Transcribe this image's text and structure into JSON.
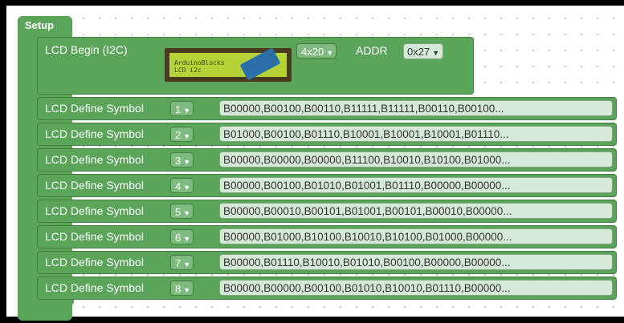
{
  "setup": {
    "label": "Setup"
  },
  "begin": {
    "label": "LCD Begin (I2C)",
    "image_text_line1": "ArduinoBlocks",
    "image_text_line2": "LCD i2c",
    "size_value": "4x20",
    "addr_label": "ADDR",
    "addr_value": "0x27"
  },
  "symbol_label": "LCD Define Symbol",
  "symbols": [
    {
      "index": "1",
      "value": "B00000,B00100,B00110,B11111,B11111,B00110,B00100..."
    },
    {
      "index": "2",
      "value": "B01000,B00100,B01110,B10001,B10001,B10001,B01110..."
    },
    {
      "index": "3",
      "value": "B00000,B00000,B00000,B11100,B10010,B10100,B01000..."
    },
    {
      "index": "4",
      "value": "B00000,B00100,B01010,B01001,B01110,B00000,B00000..."
    },
    {
      "index": "5",
      "value": "B00000,B00010,B00101,B01001,B00101,B00010,B00000..."
    },
    {
      "index": "6",
      "value": "B00000,B01000,B10100,B10010,B10100,B01000,B00000..."
    },
    {
      "index": "7",
      "value": "B00000,B01110,B10010,B01010,B00100,B00000,B00000..."
    },
    {
      "index": "8",
      "value": "B00000,B00000,B00100,B01010,B10010,B01110,B00000..."
    }
  ],
  "colors": {
    "block": "#5ba55b",
    "field": "#d6e9d6"
  },
  "icons": {
    "dropdown": "chevron-down-icon"
  }
}
